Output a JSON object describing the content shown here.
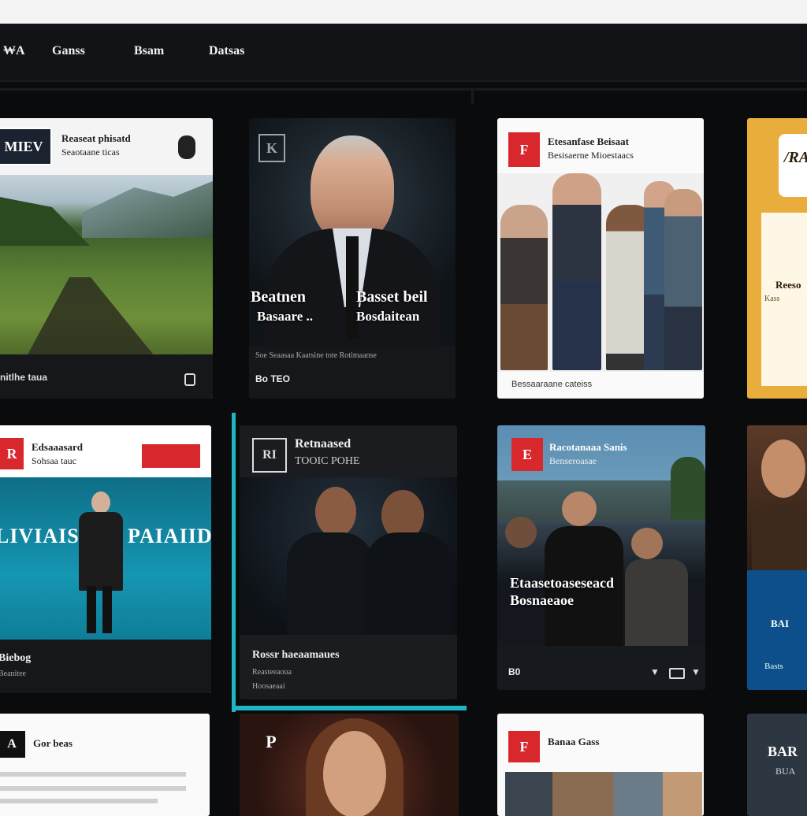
{
  "nav": {
    "items": [
      "₩A",
      "Ganss",
      "Bsam",
      "Datsas"
    ]
  },
  "cards": {
    "c1": {
      "logo": "MIEV",
      "title": "Reaseat phisatd",
      "sub": "Seaotaane ticas",
      "foot": "nitlhe taua"
    },
    "c2": {
      "logo": "K",
      "overlay1": "Beatnen",
      "overlay2": "Basaare ..",
      "overlay3": "Basset beil",
      "overlay4": "Bosdaitean",
      "caption": "Soe Seaasaa  Kaatsine  tote Rotimaanse",
      "foot": "Bo  TEO"
    },
    "c3": {
      "logo": "F",
      "title": "Etesanfase Beisaat",
      "sub": "Besisaerne Mioestaacs",
      "foot": "Bessaaraane cateiss"
    },
    "c4": {
      "logo": "/RA",
      "side1": "Reeso",
      "side2": "Kass"
    },
    "c5": {
      "logo": "R",
      "title": "Edsaaasard",
      "sub": "Sohsaa tauc",
      "banner1": "LIVIAIS",
      "banner2": "PAIAIID",
      "foot": "Biebog",
      "foot2": "Beanitee"
    },
    "c6": {
      "logo": "RI",
      "title": "Retnaased",
      "sub": "TOOIC POHE",
      "foot": "Rossr haeaamaues",
      "foot2": "Reasteeaoua",
      "foot3": "Hoosaeaai"
    },
    "c7": {
      "logo": "E",
      "title": "Racotanaaa Sanis",
      "sub": "Benseroasae",
      "overlay1": "Etaasetoaseseacd",
      "overlay2": "Bosnaeaoe",
      "foot": "B0"
    },
    "c8": {
      "label": "BAI",
      "label2": "Basts"
    },
    "c9": {
      "logo": "A",
      "title": "Gor beas"
    },
    "c10": {
      "logo": "P"
    },
    "c11": {
      "logo": "F",
      "title": "Banaa Gass"
    },
    "c12": {
      "title": "BAR",
      "sub": "BUA"
    }
  },
  "colors": {
    "accent": "#21b5c3",
    "red": "#d8282e",
    "gold": "#e8ad3a",
    "teal_bg": "#1596b2"
  }
}
